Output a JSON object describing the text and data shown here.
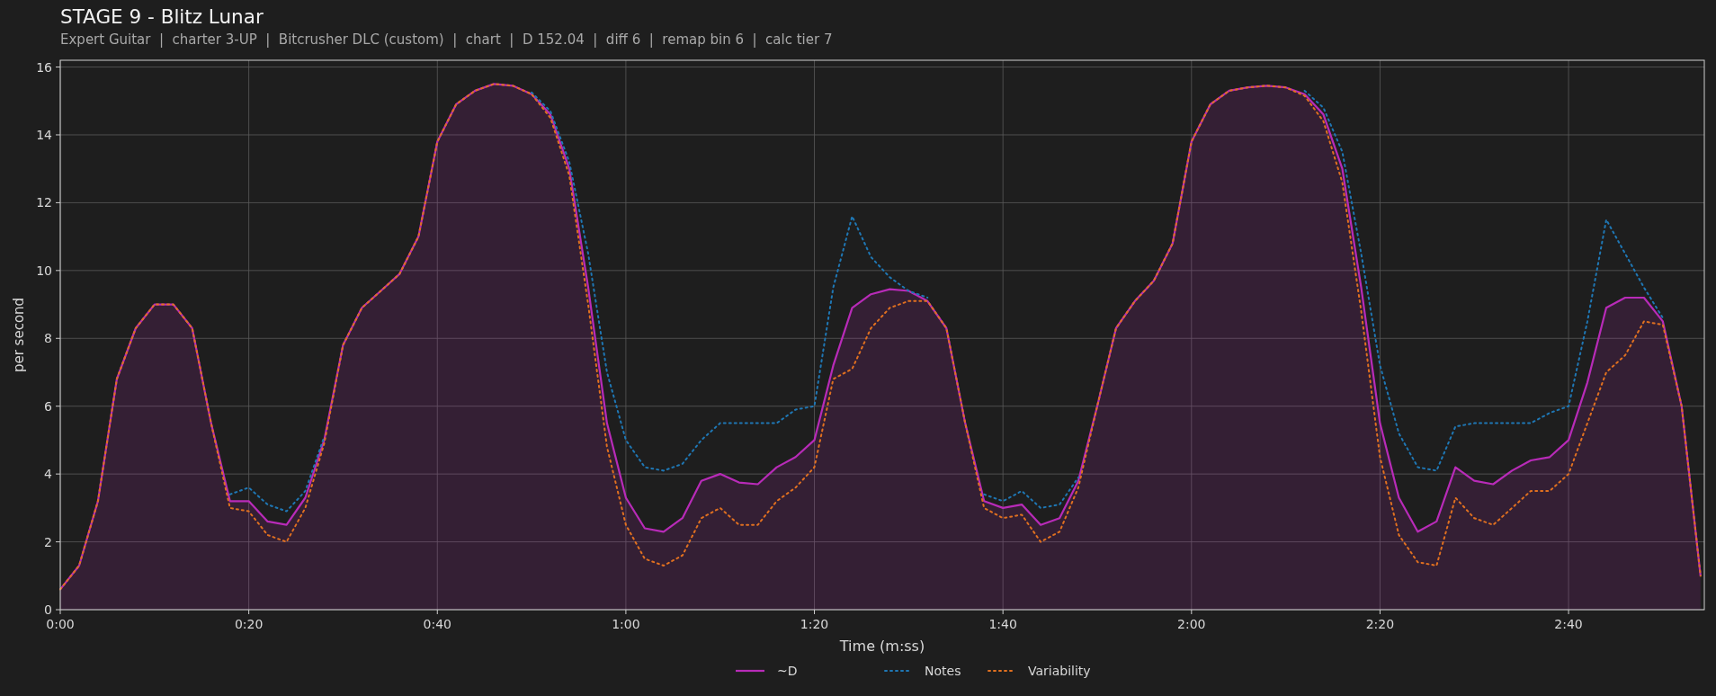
{
  "header": {
    "title": "STAGE 9 - Blitz Lunar",
    "subtitle": "Expert Guitar  |  charter 3-UP  |  Bitcrusher DLC (custom)  |  chart  |  D 152.04  |  diff 6  |  remap bin 6  |  calc tier 7"
  },
  "chart": {
    "chart_data": {
      "type": "line",
      "xlabel": "Time (m:ss)",
      "ylabel": "per second",
      "grid": true,
      "legend": true,
      "x": [
        0,
        2,
        4,
        6,
        8,
        10,
        12,
        14,
        16,
        18,
        20,
        22,
        24,
        26,
        28,
        30,
        32,
        34,
        36,
        38,
        40,
        42,
        44,
        46,
        48,
        50,
        52,
        54,
        56,
        58,
        60,
        62,
        64,
        66,
        68,
        70,
        72,
        74,
        76,
        78,
        80,
        82,
        84,
        86,
        88,
        90,
        92,
        94,
        96,
        98,
        100,
        102,
        104,
        106,
        108,
        110,
        112,
        114,
        116,
        118,
        120,
        122,
        124,
        126,
        128,
        130,
        132,
        134,
        136,
        138,
        140,
        142,
        144,
        146,
        148,
        150,
        152,
        154,
        156,
        158,
        160,
        162,
        164,
        166,
        168,
        170,
        172,
        174
      ],
      "series": [
        {
          "name": "~D",
          "type": "area",
          "color": "#b82bb8",
          "line_style": "solid",
          "values": [
            0.6,
            1.3,
            3.2,
            6.8,
            8.3,
            9.0,
            9.0,
            8.3,
            5.5,
            3.2,
            3.2,
            2.6,
            2.5,
            3.3,
            5.0,
            7.8,
            8.9,
            9.4,
            9.9,
            11.0,
            13.8,
            14.9,
            15.3,
            15.5,
            15.45,
            15.2,
            14.6,
            13.0,
            9.5,
            5.5,
            3.3,
            2.4,
            2.3,
            2.7,
            3.8,
            4.0,
            3.75,
            3.7,
            4.2,
            4.5,
            5.0,
            7.2,
            8.9,
            9.3,
            9.45,
            9.4,
            9.1,
            8.3,
            5.5,
            3.2,
            3.0,
            3.1,
            2.5,
            2.7,
            3.8,
            6.0,
            8.3,
            9.1,
            9.7,
            10.8,
            13.8,
            14.9,
            15.3,
            15.4,
            15.45,
            15.4,
            15.2,
            14.6,
            13.0,
            9.5,
            5.5,
            3.3,
            2.3,
            2.6,
            4.2,
            3.8,
            3.7,
            4.1,
            4.4,
            4.5,
            5.0,
            6.7,
            8.9,
            9.2,
            9.2,
            8.5,
            6.0,
            1.0
          ]
        },
        {
          "name": "Notes",
          "type": "line",
          "color": "#1f77b4",
          "line_style": "dotted",
          "values": [
            null,
            null,
            null,
            null,
            null,
            null,
            null,
            null,
            null,
            3.4,
            3.6,
            3.1,
            2.9,
            3.5,
            5.1,
            null,
            null,
            null,
            null,
            null,
            null,
            null,
            null,
            null,
            null,
            15.25,
            14.7,
            13.2,
            10.5,
            7.0,
            5.0,
            4.2,
            4.1,
            4.3,
            5.0,
            5.5,
            5.5,
            5.5,
            5.5,
            5.9,
            6.0,
            9.5,
            11.6,
            10.4,
            9.8,
            9.4,
            9.2,
            null,
            null,
            3.4,
            3.2,
            3.5,
            3.0,
            3.1,
            3.9,
            null,
            null,
            null,
            null,
            null,
            null,
            null,
            null,
            null,
            null,
            null,
            15.3,
            14.8,
            13.5,
            10.5,
            7.2,
            5.2,
            4.2,
            4.1,
            5.4,
            5.5,
            5.5,
            5.5,
            5.5,
            5.8,
            6.0,
            8.5,
            11.5,
            10.5,
            9.5,
            8.6,
            null,
            null
          ]
        },
        {
          "name": "Variability",
          "type": "line",
          "color": "#e07020",
          "line_style": "dotted",
          "values": [
            0.6,
            1.3,
            3.2,
            6.8,
            8.3,
            9.0,
            9.0,
            8.3,
            5.5,
            3.0,
            2.9,
            2.2,
            2.0,
            3.0,
            4.9,
            7.8,
            8.9,
            9.4,
            9.9,
            11.0,
            13.8,
            14.9,
            15.3,
            15.5,
            15.45,
            15.2,
            14.5,
            12.8,
            9.0,
            4.8,
            2.5,
            1.5,
            1.3,
            1.6,
            2.7,
            3.0,
            2.5,
            2.5,
            3.2,
            3.6,
            4.2,
            6.8,
            7.1,
            8.3,
            8.9,
            9.1,
            9.1,
            8.3,
            5.5,
            3.0,
            2.7,
            2.8,
            2.0,
            2.3,
            3.6,
            6.0,
            8.3,
            9.1,
            9.7,
            10.8,
            13.8,
            14.9,
            15.3,
            15.4,
            15.45,
            15.4,
            15.15,
            14.4,
            12.6,
            8.8,
            4.5,
            2.2,
            1.4,
            1.3,
            3.3,
            2.7,
            2.5,
            3.0,
            3.5,
            3.5,
            4.0,
            5.5,
            7.0,
            7.5,
            8.5,
            8.4,
            6.0,
            1.0
          ]
        }
      ],
      "xlim": [
        0,
        174.4
      ],
      "ylim": [
        0,
        16.2
      ],
      "xticks": [
        {
          "value": 0,
          "label": "0:00"
        },
        {
          "value": 20,
          "label": "0:20"
        },
        {
          "value": 40,
          "label": "0:40"
        },
        {
          "value": 60,
          "label": "1:00"
        },
        {
          "value": 80,
          "label": "1:20"
        },
        {
          "value": 100,
          "label": "1:40"
        },
        {
          "value": 120,
          "label": "2:00"
        },
        {
          "value": 140,
          "label": "2:20"
        },
        {
          "value": 160,
          "label": "2:40"
        }
      ],
      "yticks": [
        0,
        2,
        4,
        6,
        8,
        10,
        12,
        14,
        16
      ]
    }
  }
}
